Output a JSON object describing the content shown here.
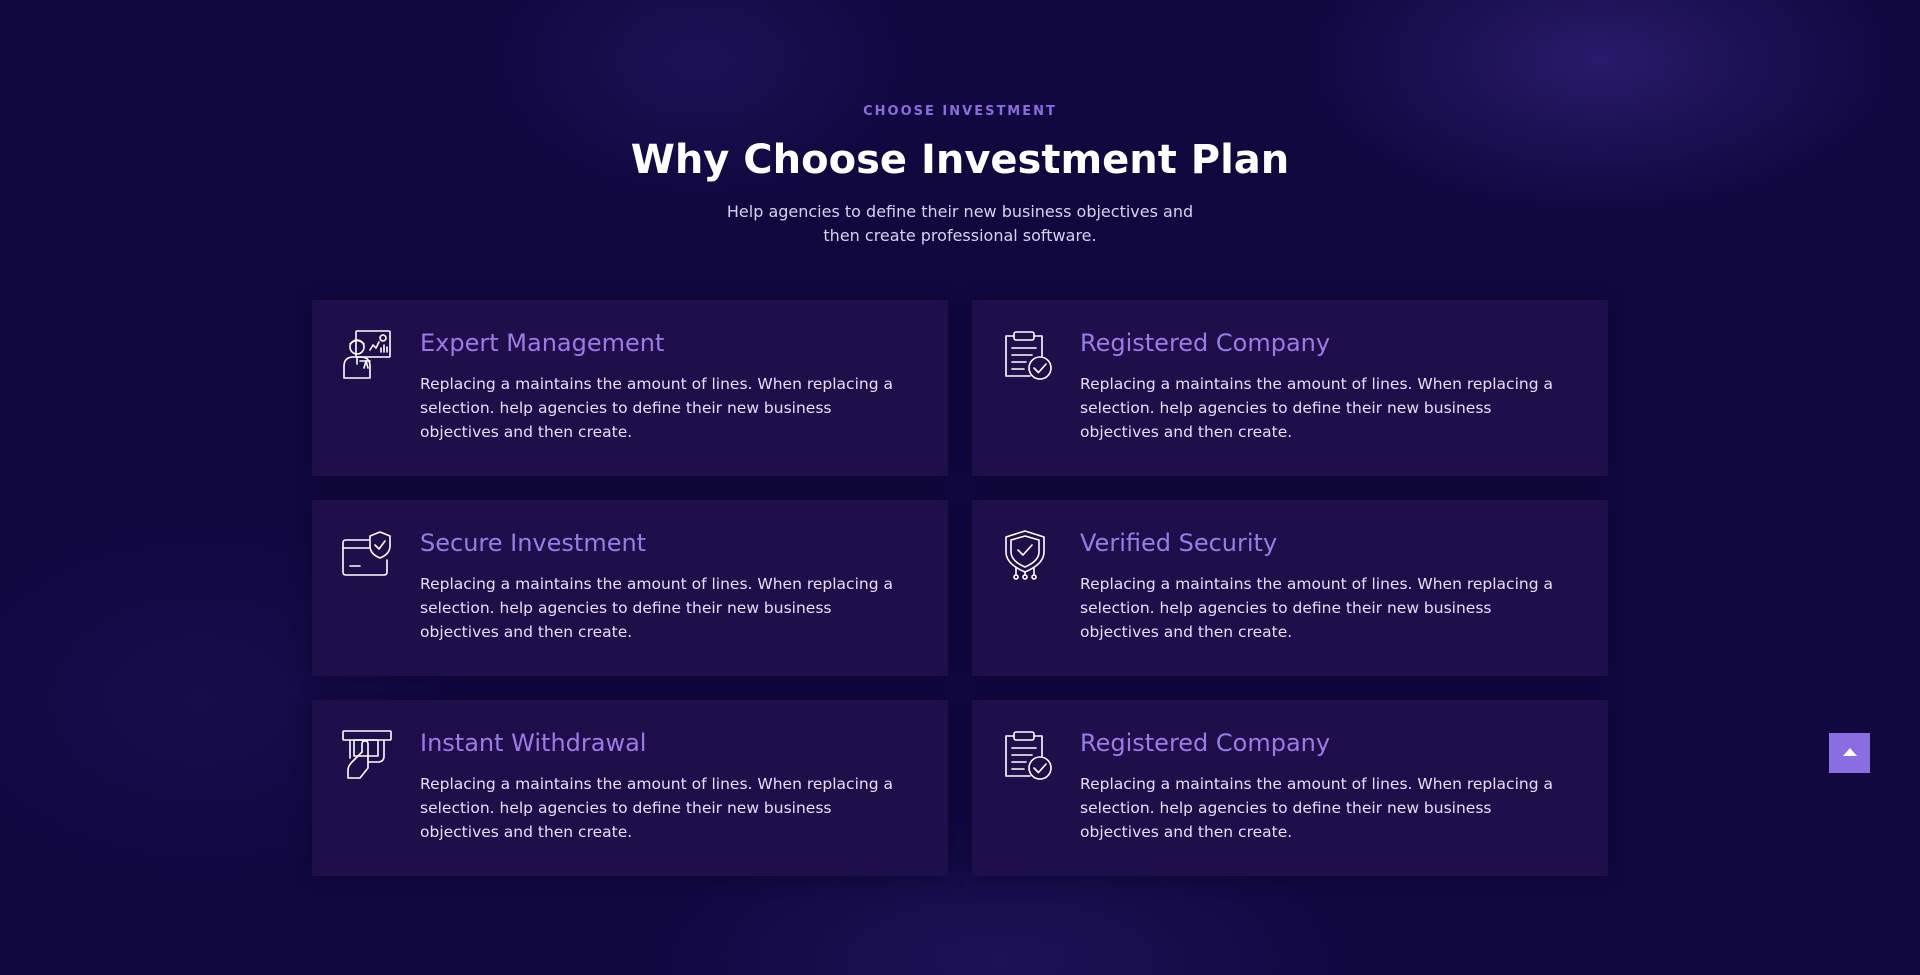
{
  "header": {
    "eyebrow": "CHOOSE INVESTMENT",
    "title": "Why Choose Investment Plan",
    "subtitle": "Help agencies to define their new business objectives and then create professional software."
  },
  "features": [
    {
      "title": "Expert Management",
      "text": "Replacing a maintains the amount of lines. When replacing a selection. help agencies to define their new business objectives and then create.",
      "icon": "expert-presenter-icon"
    },
    {
      "title": "Registered Company",
      "text": "Replacing a maintains the amount of lines. When replacing a selection. help agencies to define their new business objectives and then create.",
      "icon": "clipboard-check-icon"
    },
    {
      "title": "Secure Investment",
      "text": "Replacing a maintains the amount of lines. When replacing a selection. help agencies to define their new business objectives and then create.",
      "icon": "card-shield-icon"
    },
    {
      "title": "Verified Security",
      "text": "Replacing a maintains the amount of lines. When replacing a selection. help agencies to define their new business objectives and then create.",
      "icon": "shield-check-icon"
    },
    {
      "title": "Instant Withdrawal",
      "text": "Replacing a maintains the amount of lines. When replacing a selection. help agencies to define their new business objectives and then create.",
      "icon": "atm-withdrawal-icon"
    },
    {
      "title": "Registered Company",
      "text": "Replacing a maintains the amount of lines. When replacing a selection. help agencies to define their new business objectives and then create.",
      "icon": "clipboard-check-icon"
    }
  ],
  "scroll_top": {
    "icon": "arrow-up-icon"
  },
  "colors": {
    "background": "#110840",
    "card": "#1e0f4a",
    "accent": "#8a6de0",
    "heading": "#9a7ce8"
  }
}
